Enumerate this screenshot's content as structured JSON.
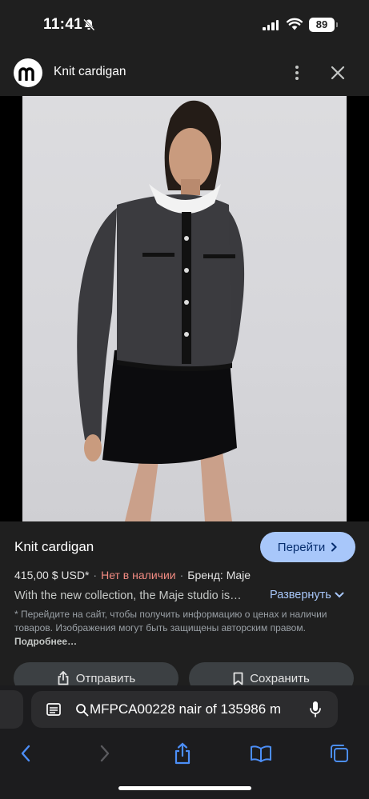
{
  "status_bar": {
    "time": "11:41",
    "battery": "89"
  },
  "header": {
    "logo_letter": "m",
    "title": "Knit cardigan"
  },
  "product": {
    "title": "Knit cardigan",
    "visit_label": "Перейти",
    "price": "415,00 $ USD*",
    "stock": "Нет в наличии",
    "brand": "Бренд: Maje",
    "description": "With the new collection, the Maje studio is…",
    "expand_label": "Развернуть",
    "disclaimer": "* Перейдите на сайт, чтобы получить информацию о ценах и наличии товаров. Изображения могут быть защищены авторским правом.",
    "more_label": "Подробнее…",
    "share_label": "Отправить",
    "save_label": "Сохранить"
  },
  "browser": {
    "address": "MFPCA00228 nair of 135986 m"
  },
  "colors": {
    "accent": "#a8c7fa",
    "out_of_stock": "#f28b82",
    "panel": "#1f1f1f"
  },
  "icons": [
    "bell-slash-icon",
    "signal-icon",
    "wifi-icon",
    "battery-icon",
    "more-vert-icon",
    "close-icon",
    "lens-icon",
    "chevron-right-icon",
    "chevron-down-icon",
    "share-icon",
    "bookmark-icon",
    "reader-icon",
    "search-icon",
    "mic-icon",
    "back-icon",
    "forward-icon",
    "bookmarks-icon",
    "tabs-icon"
  ]
}
